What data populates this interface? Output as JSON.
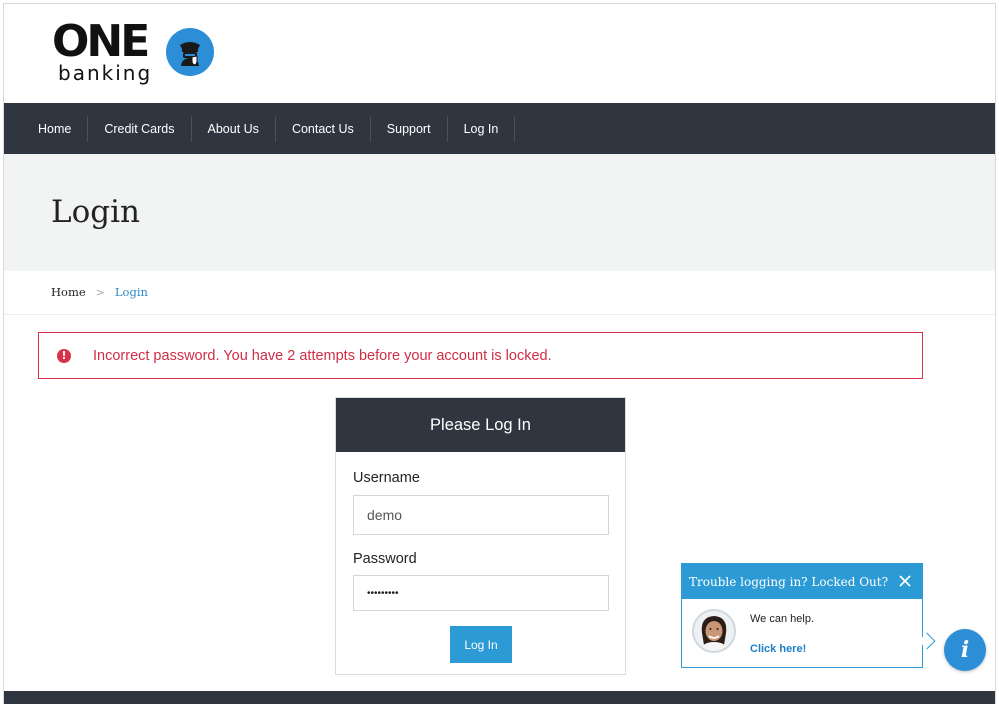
{
  "brand": {
    "logo_word": "ONE",
    "logo_sub": "banking",
    "logo_icon": "banker-icon",
    "accent_color": "#2c8ed6"
  },
  "nav": {
    "items": [
      {
        "label": "Home"
      },
      {
        "label": "Credit Cards"
      },
      {
        "label": "About Us"
      },
      {
        "label": "Contact Us"
      },
      {
        "label": "Support"
      },
      {
        "label": "Log In"
      }
    ],
    "background": "#2f3640"
  },
  "page": {
    "title": "Login"
  },
  "breadcrumb": {
    "home": "Home",
    "separator": ">",
    "current": "Login"
  },
  "alert": {
    "icon": "exclamation-circle-icon",
    "message": "Incorrect password. You have 2 attempts before your account is locked.",
    "color": "#d9334a"
  },
  "login_panel": {
    "heading": "Please Log In",
    "username_label": "Username",
    "username_value": "demo",
    "password_label": "Password",
    "password_value": "•••••••••",
    "submit_label": "Log In"
  },
  "help_widget": {
    "title": "Trouble logging in? Locked Out?",
    "message": "We can help.",
    "link": "Click here!",
    "close_icon": "close-icon",
    "info_glyph": "i"
  }
}
